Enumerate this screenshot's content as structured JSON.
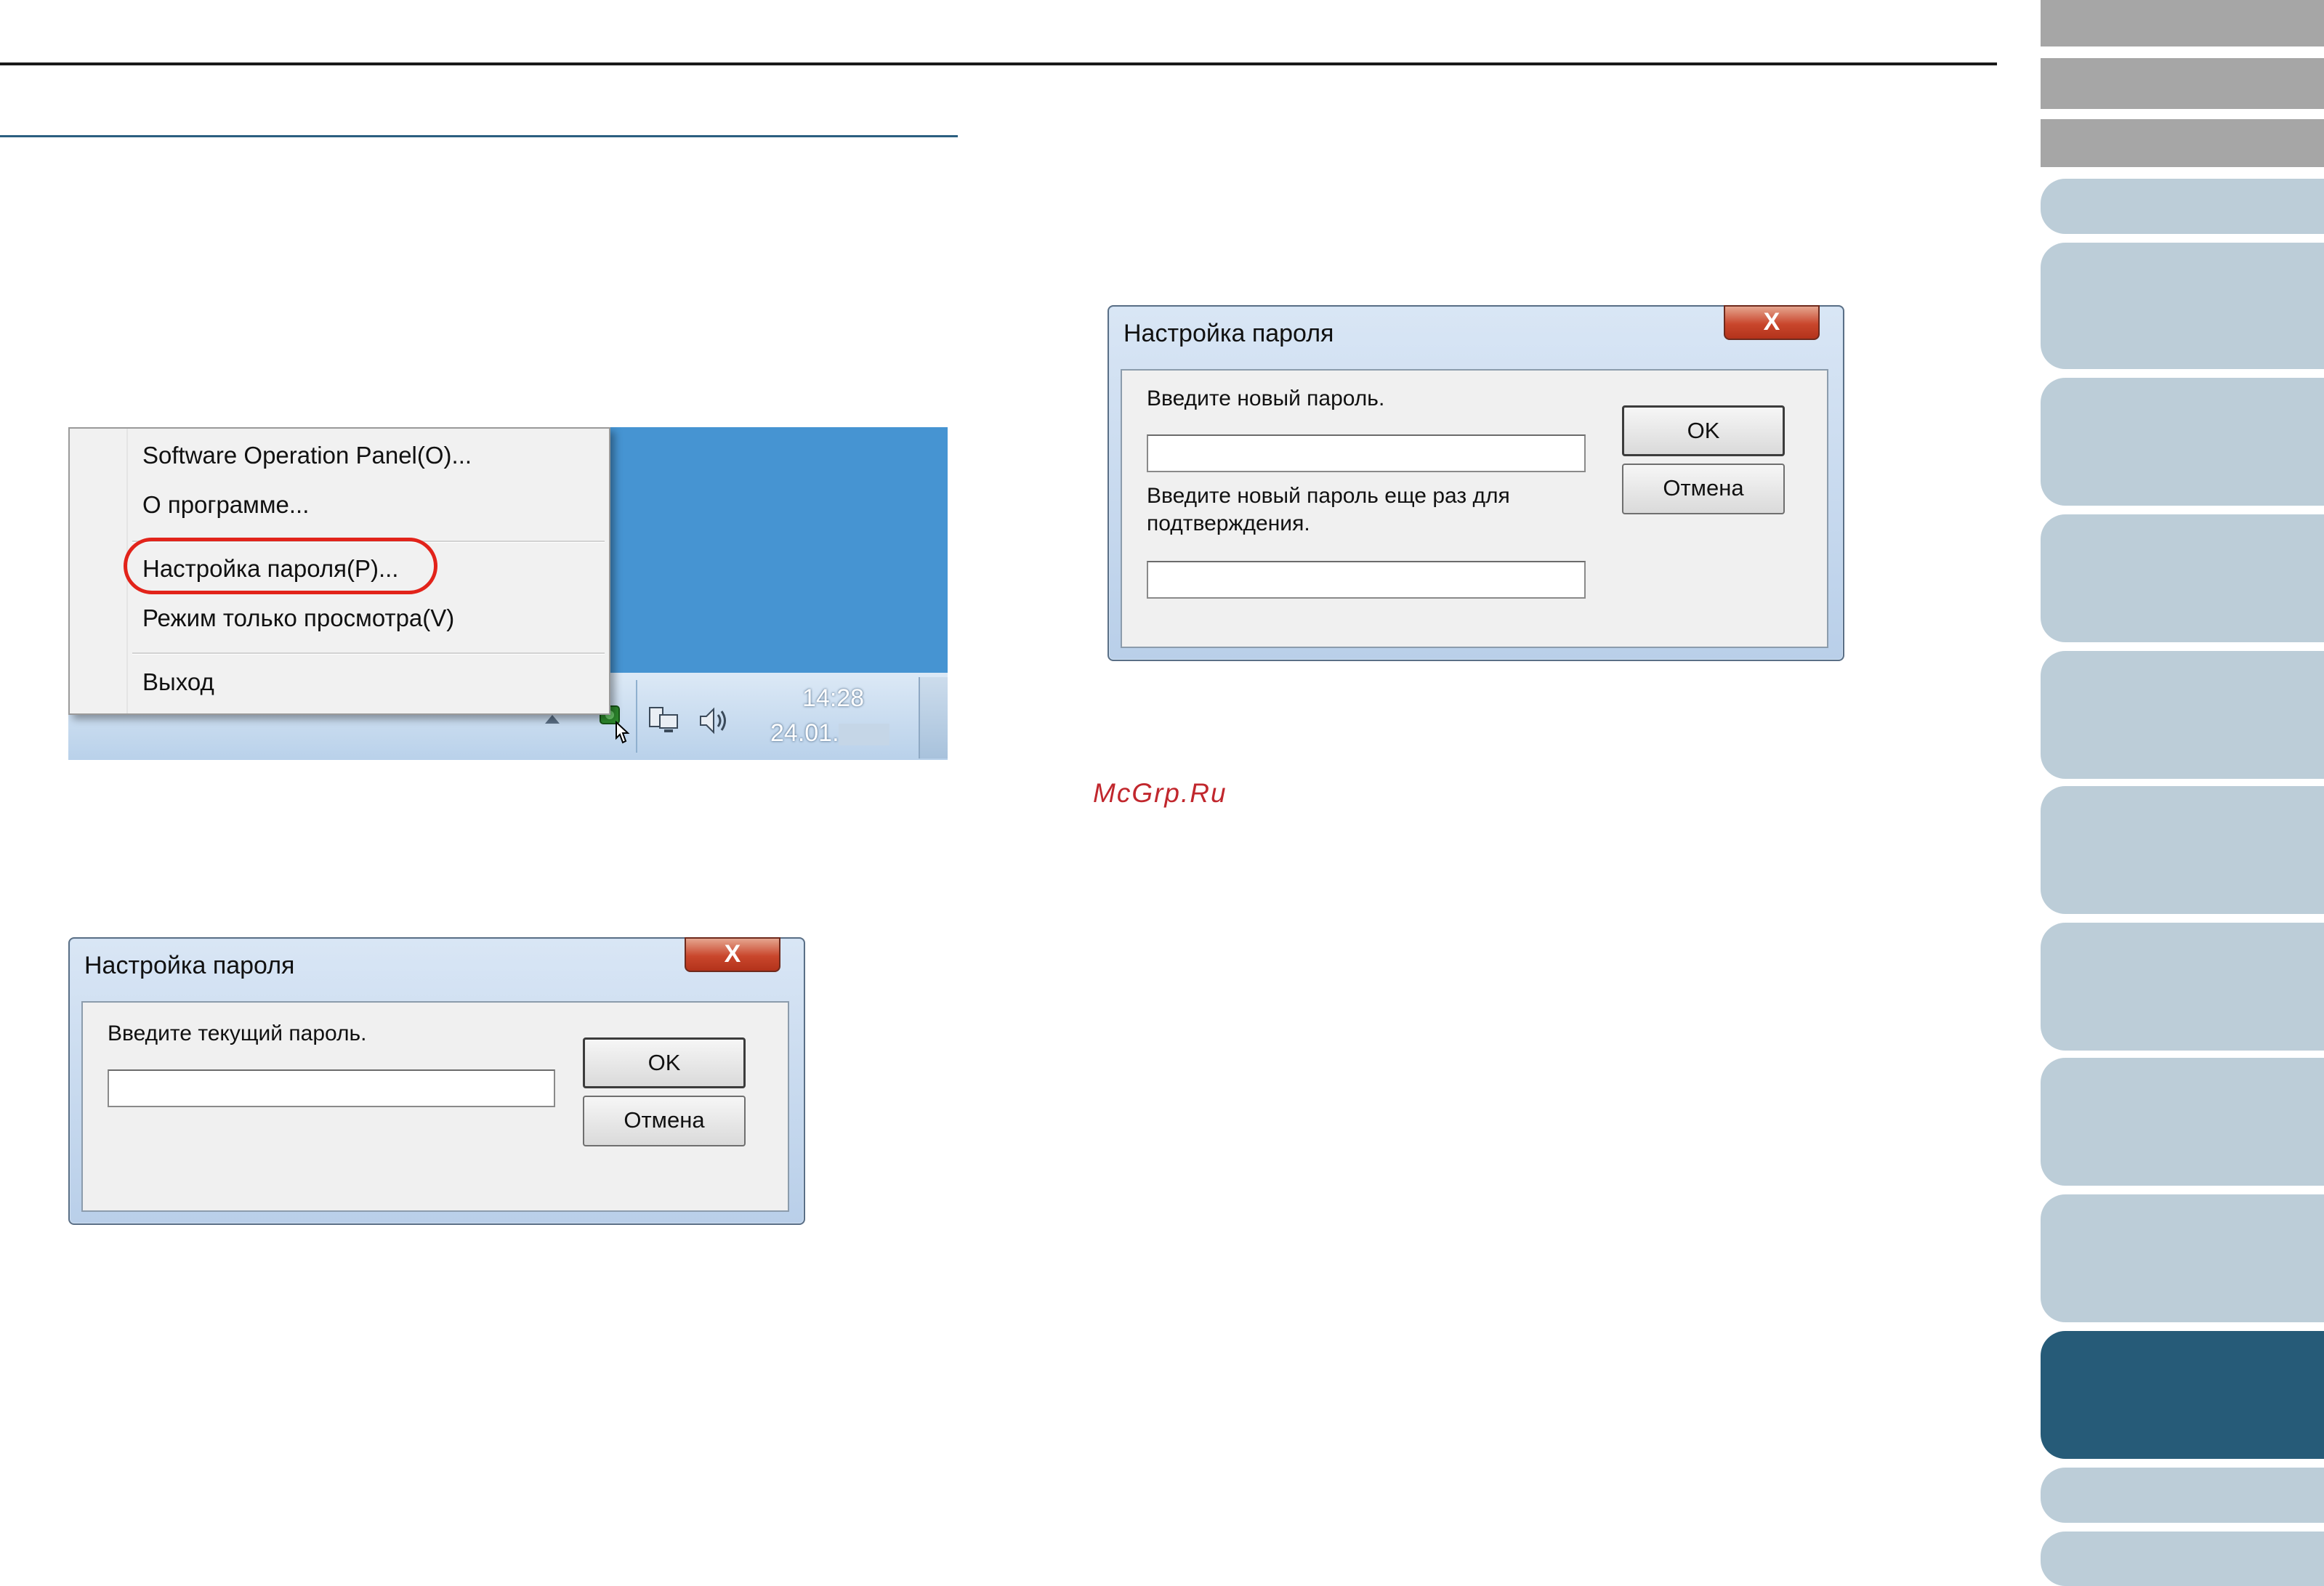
{
  "context_menu": {
    "items": [
      "Software Operation Panel(O)...",
      "О программе...",
      "Настройка пароля(P)...",
      "Режим только просмотра(V)",
      "Выход"
    ]
  },
  "taskbar": {
    "time": "14:28",
    "date": "24.01."
  },
  "dialog_current": {
    "title": "Настройка пароля",
    "close": "X",
    "prompt": "Введите текущий пароль.",
    "input_value": "",
    "ok": "OK",
    "cancel": "Отмена"
  },
  "dialog_new": {
    "title": "Настройка пароля",
    "close": "X",
    "prompt_new": "Введите новый пароль.",
    "input_new_value": "",
    "prompt_confirm": "Введите новый пароль еще раз для подтверждения.",
    "input_confirm_value": "",
    "ok": "OK",
    "cancel": "Отмена"
  },
  "watermark": "McGrp.Ru",
  "colors": {
    "accent_rule": "#2b5f80",
    "active_tab": "#265b78",
    "tab": "#bccdd8",
    "highlight_ring": "#e2231a",
    "desktop": "#4694d2"
  }
}
